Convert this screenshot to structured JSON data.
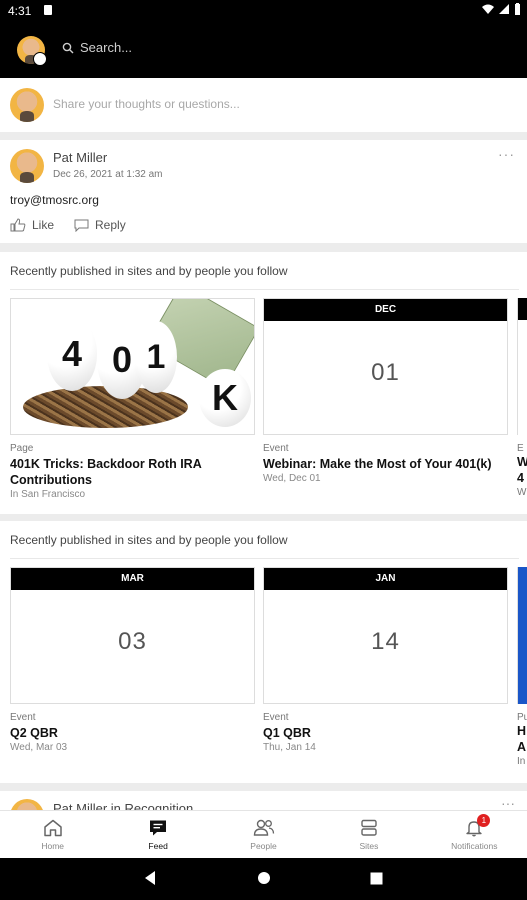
{
  "status_bar": {
    "time": "4:31"
  },
  "search": {
    "placeholder": "Search..."
  },
  "composer": {
    "placeholder": "Share your thoughts or questions..."
  },
  "post": {
    "author": "Pat Miller",
    "date": "Dec 26, 2021 at 1:32 am",
    "body": "troy@tmosrc.org",
    "like_label": "Like",
    "reply_label": "Reply",
    "more": "···"
  },
  "sections": [
    {
      "heading": "Recently published in sites and by people you follow",
      "items": [
        {
          "thumb": "401k-eggs-image",
          "egg_text": [
            "4",
            "0",
            "1",
            "K"
          ],
          "type": "Page",
          "title": "401K Tricks: Backdoor Roth IRA Contributions",
          "meta": "In San Francisco"
        },
        {
          "month": "DEC",
          "day": "01",
          "type": "Event",
          "title": "Webinar: Make the Most of Your 401(k)",
          "meta": "Wed, Dec 01"
        }
      ],
      "peek": {
        "type": "E",
        "title_lines": [
          "W",
          "4"
        ],
        "meta": "W"
      }
    },
    {
      "heading": "Recently published in sites and by people you follow",
      "items": [
        {
          "month": "MAR",
          "day": "03",
          "type": "Event",
          "title": "Q2 QBR",
          "meta": "Wed, Mar 03"
        },
        {
          "month": "JAN",
          "day": "14",
          "type": "Event",
          "title": "Q1 QBR",
          "meta": "Thu, Jan 14"
        }
      ],
      "peek": {
        "type": "Pu",
        "title_lines": [
          "H",
          "A"
        ],
        "meta": "In",
        "accent": "#1a56c8"
      }
    }
  ],
  "next_post": {
    "title": "Pat Miller in Recognition"
  },
  "tabs": [
    {
      "label": "Home",
      "icon": "home-icon",
      "active": false
    },
    {
      "label": "Feed",
      "icon": "feed-icon",
      "active": true
    },
    {
      "label": "People",
      "icon": "people-icon",
      "active": false
    },
    {
      "label": "Sites",
      "icon": "sites-icon",
      "active": false
    },
    {
      "label": "Notifications",
      "icon": "bell-icon",
      "active": false,
      "badge": "1"
    }
  ]
}
